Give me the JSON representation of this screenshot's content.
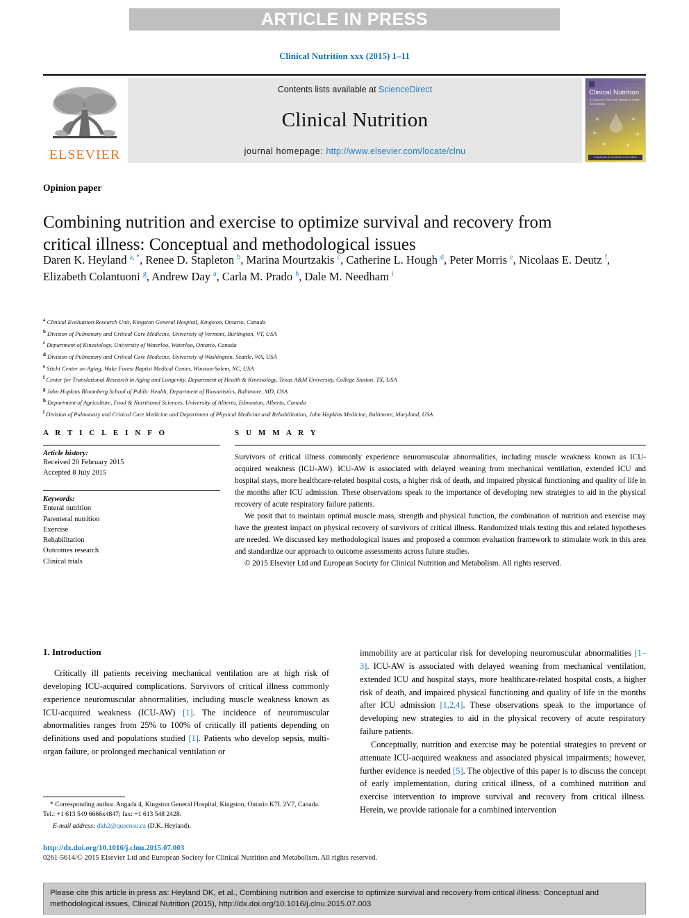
{
  "banner": {
    "text": "ARTICLE IN PRESS"
  },
  "journal_ref": "Clinical Nutrition xxx (2015) 1–11",
  "masthead": {
    "publisher_name": "ELSEVIER",
    "contents_prefix": "Contents lists available at ",
    "contents_link": "ScienceDirect",
    "journal_title": "Clinical Nutrition",
    "homepage_label": "journal homepage: ",
    "homepage_url": "http://www.elsevier.com/locate/clnu",
    "cover": {
      "title": "Clinical Nutrition",
      "subtitle": "A Journal of Food and Dietetics in Health and Disease",
      "top_code": "ISSN 0261-5614",
      "footer": "PUBLISHED BY ELSEVIER FOR ESPEN"
    }
  },
  "article": {
    "section_type": "Opinion paper",
    "title": "Combining nutrition and exercise to optimize survival and recovery from critical illness: Conceptual and methodological issues",
    "authors_html": "Daren K. Heyland <sup>a, *</sup>, Renee D. Stapleton <sup>b</sup>, Marina Mourtzakis <sup>c</sup>, Catherine L. Hough <sup>d</sup>, Peter Morris <sup>e</sup>, Nicolaas E. Deutz <sup>f</sup>, Elizabeth Colantuoni <sup>g</sup>, Andrew Day <sup>a</sup>, Carla M. Prado <sup>h</sup>, Dale M. Needham <sup>i</sup>",
    "affiliations": [
      {
        "mark": "a",
        "text": "Clinical Evaluation Research Unit, Kingston General Hospital, Kingston, Ontario, Canada"
      },
      {
        "mark": "b",
        "text": "Division of Pulmonary and Critical Care Medicine, University of Vermont, Burlington, VT, USA"
      },
      {
        "mark": "c",
        "text": "Department of Kinesiology, University of Waterloo, Waterloo, Ontario, Canada"
      },
      {
        "mark": "d",
        "text": "Division of Pulmonary and Critical Care Medicine, University of Washington, Seattle, WA, USA"
      },
      {
        "mark": "e",
        "text": "Sticht Center on Aging, Wake Forest Baptist Medical Center, Winston-Salem, NC, USA"
      },
      {
        "mark": "f",
        "text": "Center for Translational Research in Aging and Longevity, Department of Health & Kinesiology, Texas A&M University, College Station, TX, USA"
      },
      {
        "mark": "g",
        "text": "John Hopkins Bloomberg School of Public Health, Department of Biostatistics, Baltimore, MD, USA"
      },
      {
        "mark": "h",
        "text": "Department of Agriculture, Food & Nutritional Sciences, University of Alberta, Edmonton, Alberta, Canada"
      },
      {
        "mark": "i",
        "text": "Division of Pulmonary and Critical Care Medicine and Department of Physical Medicine and Rehabilitation, John Hopkins Medicine, Baltimore, Maryland, USA"
      }
    ]
  },
  "article_info": {
    "heading": "A R T I C L E   I N F O",
    "history_label": "Article history:",
    "received": "Received 20 February 2015",
    "accepted": "Accepted 8 July 2015",
    "keywords_label": "Keywords:",
    "keywords": [
      "Enteral nutrition",
      "Parenteral nutrition",
      "Exercise",
      "Rehabilitation",
      "Outcomes research",
      "Clinical trials"
    ]
  },
  "summary": {
    "heading": "S U M M A R Y",
    "paragraph1": "Survivors of critical illness commonly experience neuromuscular abnormalities, including muscle weakness known as ICU-acquired weakness (ICU-AW). ICU-AW is associated with delayed weaning from mechanical ventilation, extended ICU and hospital stays, more healthcare-related hospital costs, a higher risk of death, and impaired physical functioning and quality of life in the months after ICU admission. These observations speak to the importance of developing new strategies to aid in the physical recovery of acute respiratory failure patients.",
    "paragraph2": "We posit that to maintain optimal muscle mass, strength and physical function, the combination of nutrition and exercise may have the greatest impact on physical recovery of survivors of critical illness. Randomized trials testing this and related hypotheses are needed. We discussed key methodological issues and proposed a common evaluation framework to stimulate work in this area and standardize our approach to outcome assessments across future studies.",
    "copyright": "© 2015 Elsevier Ltd and European Society for Clinical Nutrition and Metabolism. All rights reserved."
  },
  "introduction": {
    "heading": "1.  Introduction",
    "left_paragraph_html": "Critically ill patients receiving mechanical ventilation are at high risk of developing ICU-acquired complications. Survivors of critical illness commonly experience neuromuscular abnormalities, including muscle weakness known as ICU-acquired weakness (ICU-AW) <span class=\"ref\">[1]</span>. The incidence of neuromuscular abnormalities ranges from 25% to 100% of critically ill patients depending on definitions used and populations studied <span class=\"ref\">[1]</span>. Patients who develop sepsis, multi-organ failure, or prolonged mechanical ventilation or",
    "right_paragraph1_html": "immobility are at particular risk for developing neuromuscular abnormalities <span class=\"ref\">[1–3]</span>. ICU-AW is associated with delayed weaning from mechanical ventilation, extended ICU and hospital stays, more healthcare-related hospital costs, a higher risk of death, and impaired physical functioning and quality of life in the months after ICU admission <span class=\"ref\">[1,2,4]</span>. These observations speak to the importance of developing new strategies to aid in the physical recovery of acute respiratory failure patients.",
    "right_paragraph2_html": "Conceptually, nutrition and exercise may be potential strategies to prevent or attenuate ICU-acquired weakness and associated physical impairments; however, further evidence is needed <span class=\"ref\">[5]</span>. The objective of this paper is to discuss the concept of early implementation, during critical illness, of a combined nutrition and exercise intervention to improve survival and recovery from critical illness. Herein, we provide rationale for a combined intervention"
  },
  "footnote": {
    "correspondence_html": "* Corresponding author. Angada 4, Kingston General Hospital, Kingston, Ontario K7L 2V7, Canada. Tel.: +1 613 549 6666x4847; fax: +1 613 548 2428.",
    "email_label": "E-mail address:",
    "email": "dkh2@queensu.ca",
    "email_owner": "(D.K. Heyland)."
  },
  "doi": "http://dx.doi.org/10.1016/j.clnu.2015.07.003",
  "copyright_line": "0261-5614/© 2015 Elsevier Ltd and European Society for Clinical Nutrition and Metabolism. All rights reserved.",
  "cite_box": {
    "text": "Please cite this article in press as: Heyland DK, et al., Combining nutrition and exercise to optimize survival and recovery from critical illness: Conceptual and methodological issues, Clinical Nutrition (2015), http://dx.doi.org/10.1016/j.clnu.2015.07.003"
  },
  "colors": {
    "link": "#1f7bbf",
    "banner_bg": "#bfbfbf",
    "masthead_bg": "#e6e6e6",
    "elsevier_orange": "#e87722",
    "cite_bg": "#c9c9c9"
  }
}
